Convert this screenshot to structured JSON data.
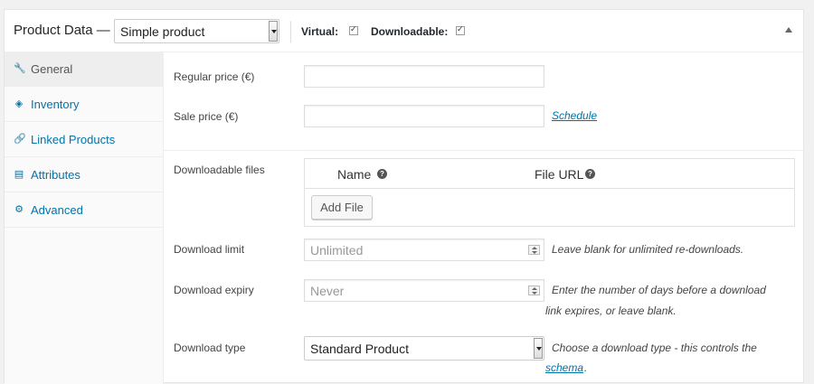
{
  "header": {
    "title": "Product Data —",
    "product_type": "Simple product",
    "virtual_label": "Virtual:",
    "downloadable_label": "Downloadable:"
  },
  "sidebar": {
    "items": [
      {
        "label": "General",
        "icon": "wrench-icon",
        "active": true
      },
      {
        "label": "Inventory",
        "icon": "tag-icon",
        "active": false
      },
      {
        "label": "Linked Products",
        "icon": "link-icon",
        "active": false
      },
      {
        "label": "Attributes",
        "icon": "table-icon",
        "active": false
      },
      {
        "label": "Advanced",
        "icon": "gear-icon",
        "active": false
      }
    ]
  },
  "fields": {
    "regular_price": {
      "label": "Regular price (€)",
      "value": ""
    },
    "sale_price": {
      "label": "Sale price (€)",
      "value": "",
      "schedule_link": "Schedule"
    },
    "downloadable_files": {
      "label": "Downloadable files",
      "col_name": "Name",
      "col_url": "File URL",
      "add_button": "Add File"
    },
    "download_limit": {
      "label": "Download limit",
      "placeholder": "Unlimited",
      "help": "Leave blank for unlimited re-downloads."
    },
    "download_expiry": {
      "label": "Download expiry",
      "placeholder": "Never",
      "help_line1": "Enter the number of days before a download",
      "help_line2": "link expires, or leave blank."
    },
    "download_type": {
      "label": "Download type",
      "value": "Standard Product",
      "help_line1": "Choose a download type - this controls the",
      "help_link": "schema",
      "help_end": "."
    }
  },
  "colors": {
    "link": "#0073aa",
    "active_tab_bg": "#eeeeee"
  }
}
